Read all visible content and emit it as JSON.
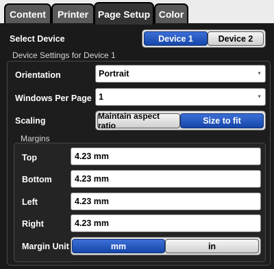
{
  "tabs": [
    "Content",
    "Printer",
    "Page Setup",
    "Color"
  ],
  "active_tab": "Page Setup",
  "select_device": {
    "label": "Select Device",
    "options": [
      "Device 1",
      "Device 2"
    ],
    "selected": "Device 1"
  },
  "device_settings": {
    "title": "Device Settings for Device 1",
    "orientation": {
      "label": "Orientation",
      "value": "Portrait"
    },
    "windows_per_page": {
      "label": "Windows Per Page",
      "value": "1"
    },
    "scaling": {
      "label": "Scaling",
      "options": [
        "Maintain aspect ratio",
        "Size to fit"
      ],
      "selected": "Size to fit"
    }
  },
  "margins": {
    "title": "Margins",
    "top": {
      "label": "Top",
      "value": "4.23 mm"
    },
    "bottom": {
      "label": "Bottom",
      "value": "4.23 mm"
    },
    "left": {
      "label": "Left",
      "value": "4.23 mm"
    },
    "right": {
      "label": "Right",
      "value": "4.23 mm"
    },
    "unit": {
      "label": "Margin Unit",
      "options": [
        "mm",
        "in"
      ],
      "selected": "mm"
    }
  },
  "colors": {
    "accent": "#1646a8",
    "background": "#111111",
    "tab_active": "#333333",
    "tab_inactive": "#595959"
  },
  "icons": {
    "dropdown": "chevron-down-icon"
  }
}
